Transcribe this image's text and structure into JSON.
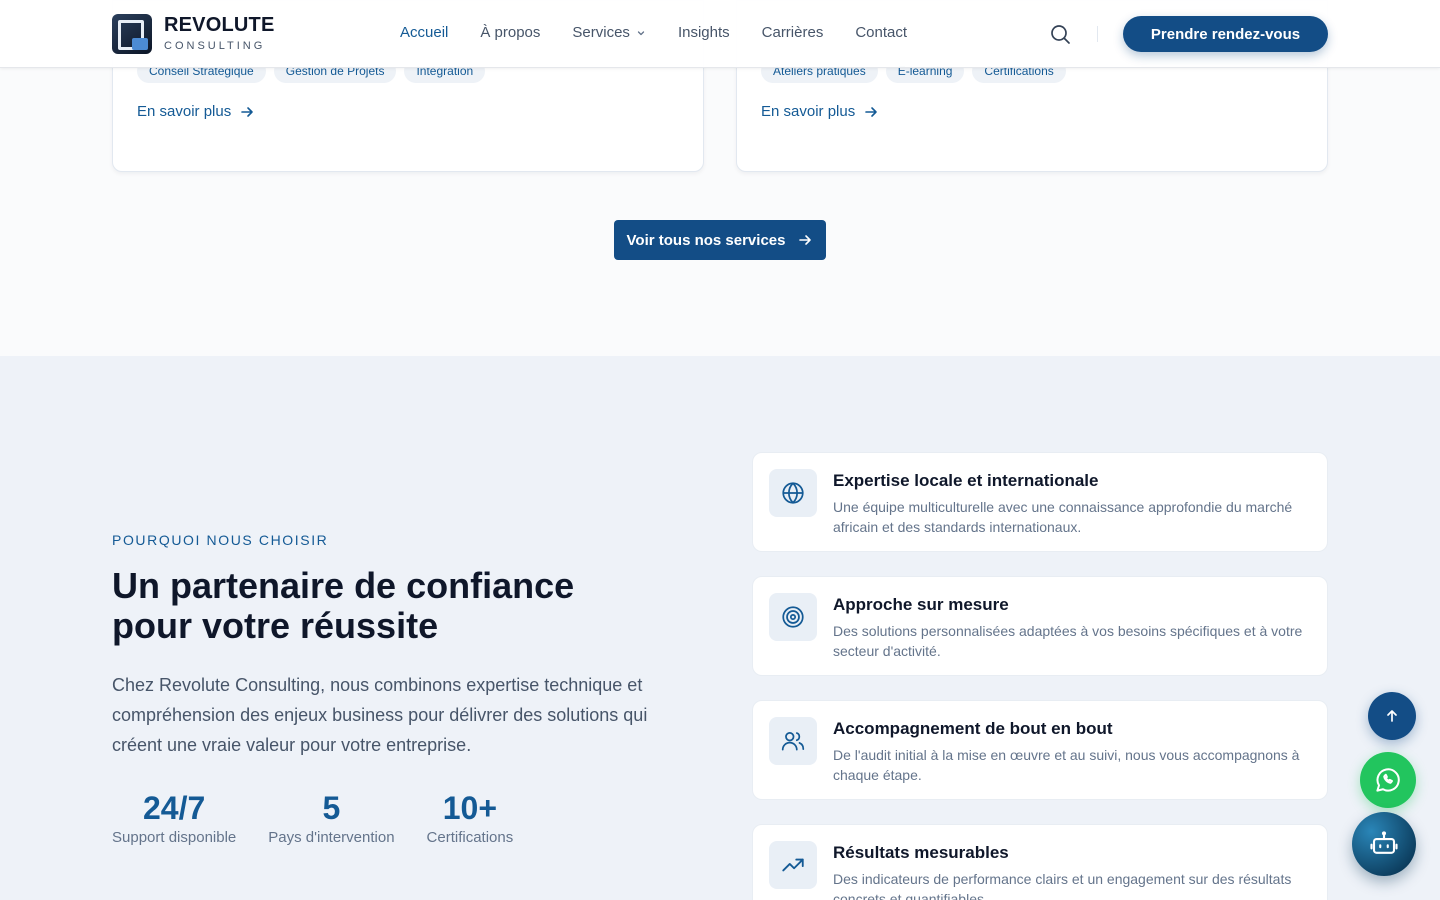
{
  "header": {
    "brand_title": "REVOLUTE",
    "brand_sub": "CONSULTING",
    "nav": [
      {
        "label": "Accueil"
      },
      {
        "label": "À propos"
      },
      {
        "label": "Services"
      },
      {
        "label": "Insights"
      },
      {
        "label": "Carrières"
      },
      {
        "label": "Contact"
      }
    ],
    "cta": "Prendre rendez-vous"
  },
  "services": {
    "cards": [
      {
        "tags": [
          "Conseil Stratégique",
          "Gestion de Projets",
          "Intégration"
        ],
        "link": "En savoir plus"
      },
      {
        "tags": [
          "Ateliers pratiques",
          "E-learning",
          "Certifications"
        ],
        "link": "En savoir plus"
      }
    ],
    "all_button": "Voir tous nos services"
  },
  "why": {
    "eyebrow": "POURQUOI NOUS CHOISIR",
    "title_line1": "Un partenaire de confiance",
    "title_line2": "pour votre réussite",
    "description": "Chez Revolute Consulting, nous combinons expertise technique et compréhension des enjeux business pour délivrer des solutions qui créent une vraie valeur pour votre entreprise.",
    "stats": [
      {
        "value": "24/7",
        "label": "Support disponible"
      },
      {
        "value": "5",
        "label": "Pays d'intervention"
      },
      {
        "value": "10+",
        "label": "Certifications"
      }
    ],
    "features": [
      {
        "icon": "globe-icon",
        "title": "Expertise locale et internationale",
        "desc": "Une équipe multiculturelle avec une connaissance approfondie du marché africain et des standards internationaux."
      },
      {
        "icon": "target-icon",
        "title": "Approche sur mesure",
        "desc": "Des solutions personnalisées adaptées à vos besoins spécifiques et à votre secteur d'activité."
      },
      {
        "icon": "users-icon",
        "title": "Accompagnement de bout en bout",
        "desc": "De l'audit initial à la mise en œuvre et au suivi, nous vous accompagnons à chaque étape."
      },
      {
        "icon": "trending-up-icon",
        "title": "Résultats mesurables",
        "desc": "Des indicateurs de performance clairs et un engagement sur des résultats concrets et quantifiables."
      }
    ]
  },
  "colors": {
    "brand": "#134d86",
    "accent_text": "#145a95",
    "section_bg": "#eef2f8",
    "whatsapp": "#22c55e"
  }
}
